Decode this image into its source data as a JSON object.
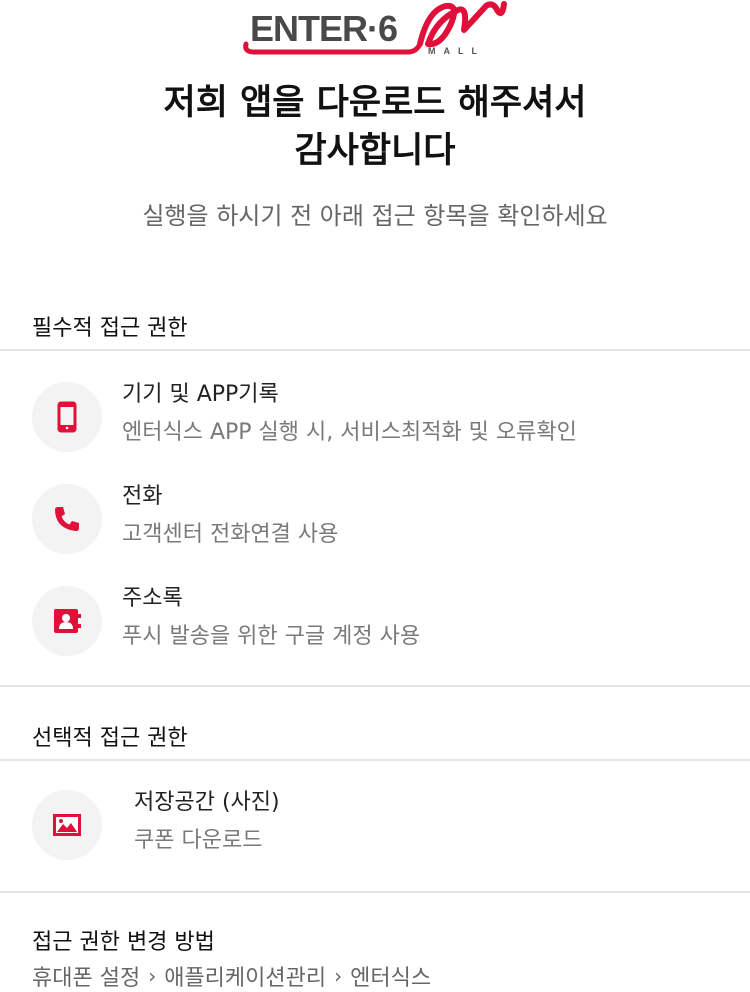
{
  "logo": {
    "text": "ENTER·6",
    "sub": "MALL"
  },
  "header": {
    "title_line1": "저희 앱을 다운로드 해주셔서",
    "title_line2": "감사합니다",
    "subtitle": "실행을 하시기 전 아래 접근 항목을 확인하세요"
  },
  "required": {
    "title": "필수적 접근 권한",
    "items": [
      {
        "icon": "smartphone-icon",
        "name": "기기 및 APP기록",
        "desc": "엔터식스 APP 실행 시, 서비스최적화 및 오류확인"
      },
      {
        "icon": "phone-icon",
        "name": "전화",
        "desc": "고객센터 전화연결 사용"
      },
      {
        "icon": "contact-card-icon",
        "name": "주소록",
        "desc": "푸시 발송을 위한 구글 계정 사용"
      }
    ]
  },
  "optional": {
    "title": "선택적 접근 권한",
    "items": [
      {
        "icon": "image-icon",
        "name": "저장공간 (사진)",
        "desc": "쿠폰 다운로드"
      }
    ]
  },
  "howto": {
    "title": "접근 권한 변경 방법",
    "path": [
      "휴대폰 설정",
      "애플리케이션관리",
      "엔터식스"
    ]
  },
  "colors": {
    "accent": "#e0103a",
    "icon_bg": "#f3f3f3",
    "divider": "#e4e4e4"
  }
}
